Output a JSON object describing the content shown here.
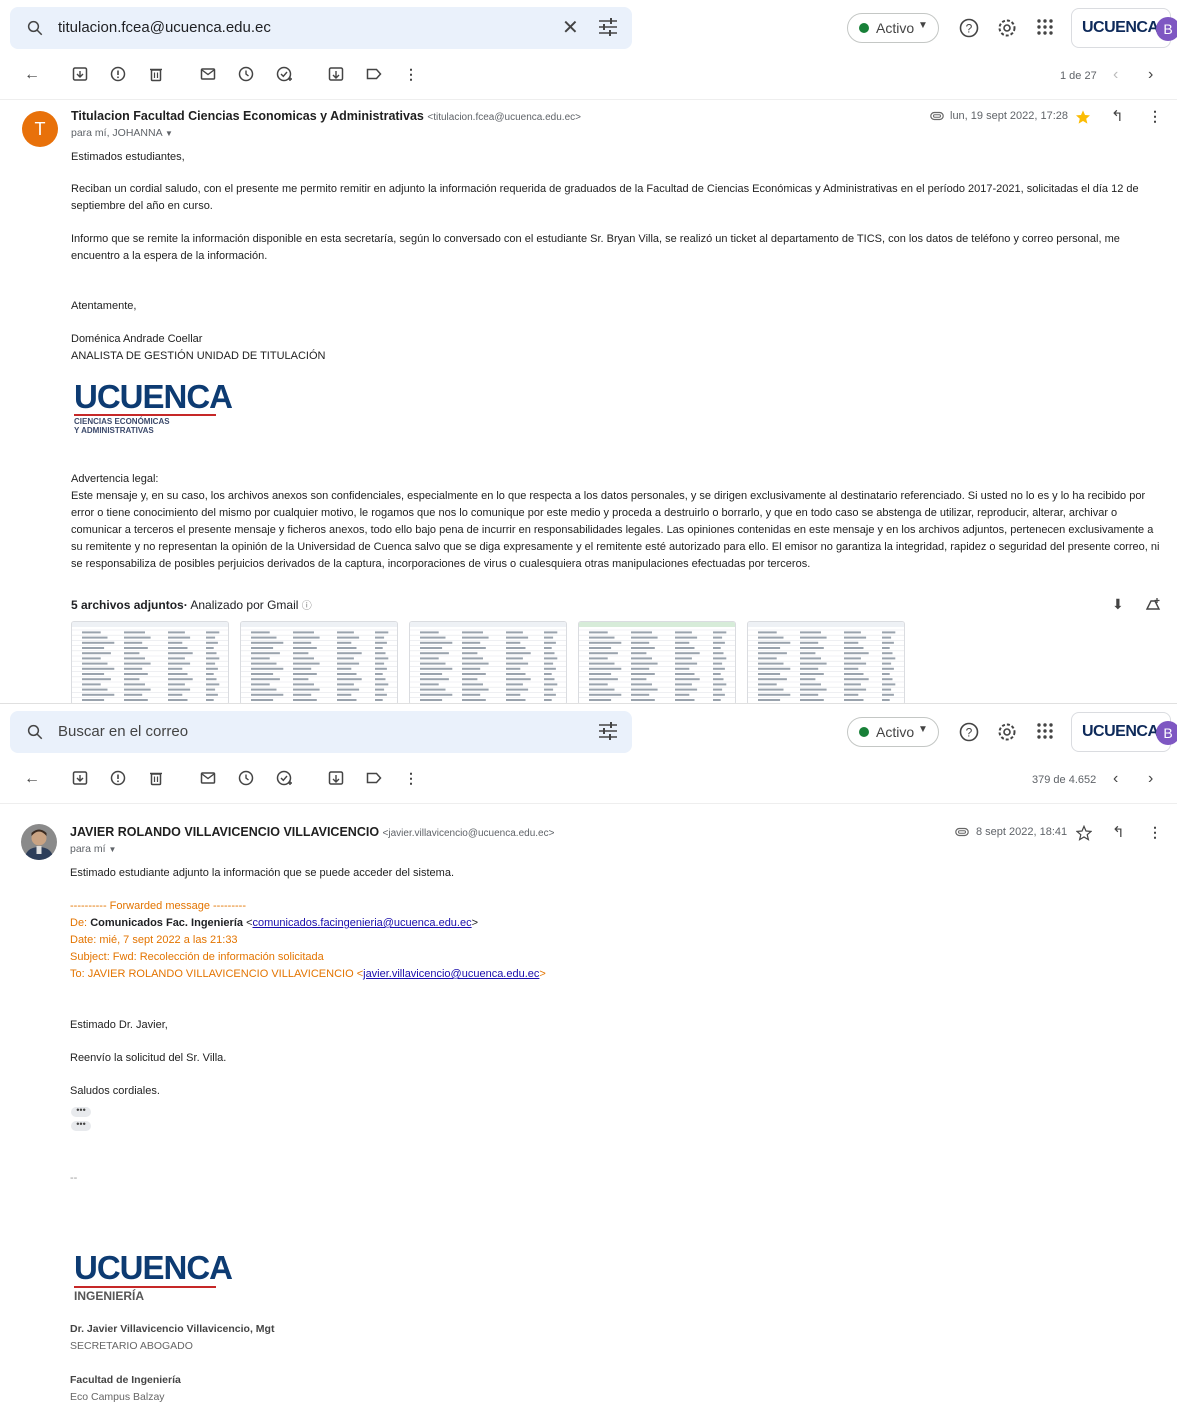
{
  "mail1": {
    "search_value": "titulacion.fcea@ucuenca.edu.ec",
    "status": "Activo",
    "brand": "UCUENCA",
    "account_initial": "B",
    "counter": "1 de 27",
    "sender_name": "Titulacion Facultad Ciencias Economicas y Administrativas",
    "sender_email": "<titulacion.fcea@ucuenca.edu.ec>",
    "recipients": "para mí, JOHANNA",
    "date": "lun, 19 sept 2022, 17:28",
    "avatar_letter": "T",
    "greeting": "Estimados estudiantes,",
    "para1": "Reciban un cordial saludo, con el presente me permito remitir en adjunto la información requerida de graduados de la Facultad de Ciencias Económicas y Administrativas en el período 2017-2021, solicitadas el día 12 de septiembre del año en curso.",
    "para2": "Informo que se remite la información disponible en esta secretaría, según lo conversado con el estudiante Sr. Bryan Villa, se realizó un ticket al departamento de TICS, con los datos de teléfono y correo personal, me encuentro a la espera de la información.",
    "closing": "Atentamente,",
    "signer_name": "Doménica Andrade Coellar",
    "signer_title": "ANALISTA DE GESTIÓN UNIDAD DE TITULACIÓN",
    "logo_text": "UCUENCA",
    "logo_sub1": "CIENCIAS ECONÓMICAS",
    "logo_sub2": "Y ADMINISTRATIVAS",
    "legal_title": "Advertencia legal:",
    "legal_text": "Este mensaje y, en su caso, los archivos anexos son confidenciales, especialmente en lo que respecta a los datos personales, y se dirigen exclusivamente al destinatario referenciado. Si usted no lo es y lo ha recibido por error o tiene conocimiento del mismo por cualquier motivo, le rogamos que nos lo comunique por este medio y proceda a destruirlo o borrarlo, y que en todo caso se abstenga de utilizar, reproducir, alterar, archivar o comunicar a terceros el presente mensaje y ficheros anexos, todo ello bajo pena de incurrir en responsabilidades legales. Las opiniones contenidas en este mensaje y en los archivos adjuntos, pertenecen exclusivamente a su remitente y no representan la opinión de la Universidad de Cuenca salvo que se diga expresamente y el remitente esté autorizado para ello. El emisor no garantiza la integridad, rapidez o seguridad del presente correo, ni se responsabiliza de posibles perjuicios derivados de la captura, incorporaciones de virus o cualesquiera otras manipulaciones efectuadas por terceros.",
    "attachments_label": "5 archivos adjuntos",
    "attachments_scan": "Analizado por Gmail",
    "attachments": [
      {
        "name": "attachment-1"
      },
      {
        "name": "attachment-2"
      },
      {
        "name": "attachment-3"
      },
      {
        "name": "attachment-4"
      },
      {
        "name": "attachment-5"
      }
    ]
  },
  "mail2": {
    "search_placeholder": "Buscar en el correo",
    "status": "Activo",
    "brand": "UCUENCA",
    "account_initial": "B",
    "counter": "379 de 4.652",
    "sender_name": "JAVIER ROLANDO VILLAVICENCIO VILLAVICENCIO",
    "sender_email": "<javier.villavicencio@ucuenca.edu.ec>",
    "recipients": "para mí",
    "date": "8 sept 2022, 18:41",
    "intro": "Estimado estudiante adjunto la información que se puede acceder del sistema.",
    "fwd_header": "---------- Forwarded message ---------",
    "from_label": "De:",
    "from_name": "Comunicados Fac. Ingeniería",
    "from_email": "comunicados.facingenieria@ucuenca.edu.ec",
    "date_line": "Date: mié, 7 sept 2022 a las 21:33",
    "subject_line": "Subject: Fwd: Recolección de información solicitada",
    "to_label": "To: JAVIER ROLANDO VILLAVICENCIO VILLAVICENCIO <",
    "to_email": "javier.villavicencio@ucuenca.edu.ec",
    "greeting": "Estimado Dr. Javier,",
    "line1": "Reenvío la solicitud del Sr. Villa.",
    "line2": "Saludos cordiales.",
    "sig_sep": "--",
    "logo_text": "UCUENCA",
    "logo_sub": "INGENIERÍA",
    "sig_name": "Dr. Javier Villavicencio Villavicencio, Mgt",
    "sig_title": "SECRETARIO ABOGADO",
    "sig_faculty": "Facultad de Ingeniería",
    "sig_campus": "Eco Campus Balzay"
  },
  "colors": {
    "accent_blue": "#0b57d0",
    "brand_navy": "#0d3b72",
    "active_green": "#188038",
    "avatar_orange": "#e8710a",
    "star_yellow": "#fbbc04"
  },
  "icons": [
    "search-icon",
    "close-icon",
    "tune-icon",
    "help-icon",
    "settings-icon",
    "apps-icon",
    "back-icon",
    "archive-icon",
    "report-icon",
    "delete-icon",
    "mail-icon",
    "snooze-icon",
    "add-task-icon",
    "move-icon",
    "label-icon",
    "more-icon",
    "attachment-icon",
    "star-icon",
    "reply-icon",
    "download-icon",
    "add-to-drive-icon"
  ]
}
